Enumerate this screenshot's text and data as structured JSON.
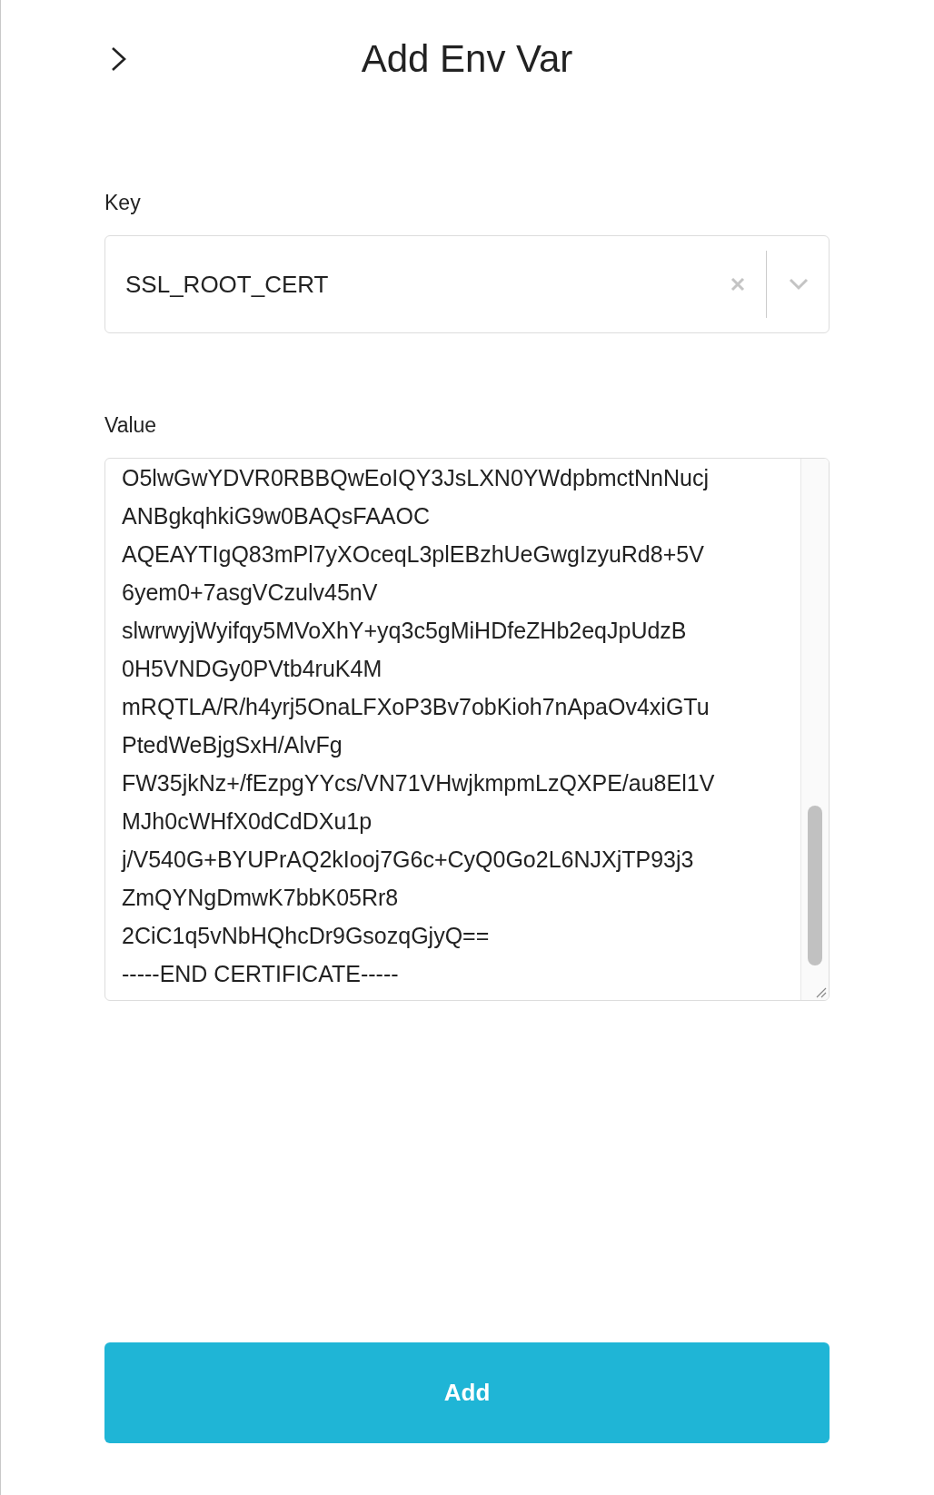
{
  "header": {
    "title": "Add Env Var"
  },
  "key_field": {
    "label": "Key",
    "value": "SSL_ROOT_CERT"
  },
  "value_field": {
    "label": "Value",
    "lines": [
      "O5lwGwYDVR0RBBQwEoIQY3JsLXN0YWdpbmctNnNucj",
      "ANBgkqhkiG9w0BAQsFAAOC",
      "AQEAYTIgQ83mPl7yXOceqL3plEBzhUeGwgIzyuRd8+5V",
      "6yem0+7asgVCzulv45nV",
      "slwrwyjWyifqy5MVoXhY+yq3c5gMiHDfeZHb2eqJpUdzB",
      "0H5VNDGy0PVtb4ruK4M",
      "mRQTLA/R/h4yrj5OnaLFXoP3Bv7obKioh7nApaOv4xiGTu",
      "PtedWeBjgSxH/AlvFg",
      "FW35jkNz+/fEzpgYYcs/VN71VHwjkmpmLzQXPE/au8El1V",
      "MJh0cWHfX0dCdDXu1p",
      "j/V540G+BYUPrAQ2kIooj7G6c+CyQ0Go2L6NJXjTP93j3",
      "ZmQYNgDmwK7bbK05Rr8",
      "2CiC1q5vNbHQhcDr9GsozqGjyQ==",
      "-----END CERTIFICATE-----"
    ]
  },
  "button": {
    "label": "Add"
  }
}
